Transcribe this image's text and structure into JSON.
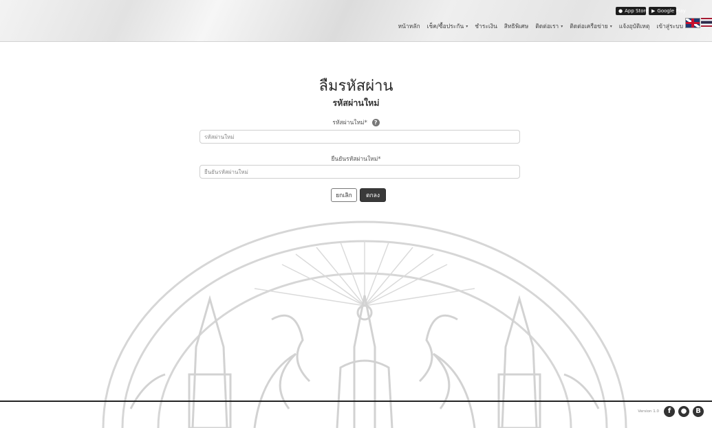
{
  "header": {
    "store_badges": {
      "app_store": "App Store",
      "google_play": "Google Play"
    },
    "nav": [
      {
        "label": "หน้าหลัก",
        "dropdown": false
      },
      {
        "label": "เช็ค/ซื้อประกัน",
        "dropdown": true
      },
      {
        "label": "ชำระเงิน",
        "dropdown": false
      },
      {
        "label": "สิทธิพิเศษ",
        "dropdown": false
      },
      {
        "label": "ติดต่อเรา",
        "dropdown": true
      },
      {
        "label": "ติดต่อเครือข่าย",
        "dropdown": true
      },
      {
        "label": "แจ้งอุบัติเหตุ",
        "dropdown": false
      },
      {
        "label": "เข้าสู่ระบบ",
        "dropdown": false
      }
    ],
    "dropdown_glyph": "▾",
    "language_flags": [
      "uk-flag-icon",
      "thai-flag-icon"
    ]
  },
  "form": {
    "title": "ลืมรหัสผ่าน",
    "subtitle": "รหัสผ่านใหม่",
    "new_password_label": "รหัสผ่านใหม่*",
    "help_glyph": "?",
    "new_password_placeholder": "รหัสผ่านใหม่",
    "new_password_value": "",
    "confirm_password_label": "ยืนยันรหัสผ่านใหม่*",
    "confirm_password_placeholder": "ยืนยันรหัสผ่านใหม่",
    "confirm_password_value": "",
    "cancel_label": "ยกเลิก",
    "ok_label": "ตกลง"
  },
  "footer": {
    "version": "Version 1.0",
    "social_icons": [
      "facebook-icon",
      "line-icon",
      "blogger-icon"
    ],
    "social_glyphs": {
      "facebook": "f",
      "line": "●",
      "blogger": "B"
    }
  },
  "colors": {
    "primary_button": "#3a3a3a",
    "text": "#2a2a2a",
    "footer_line": "#222222"
  }
}
